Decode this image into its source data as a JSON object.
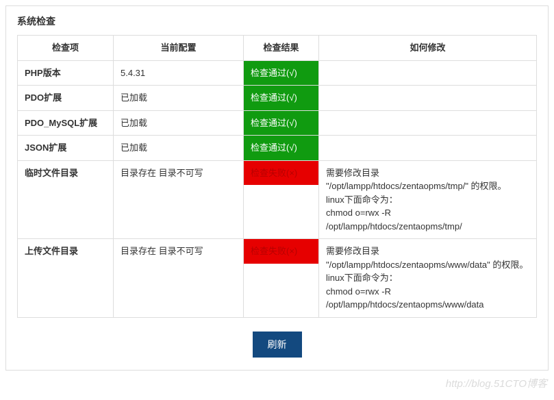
{
  "title": "系统检查",
  "headers": {
    "item": "检查项",
    "config": "当前配置",
    "result": "检查结果",
    "fix": "如何修改"
  },
  "status": {
    "pass": "检查通过(√)",
    "fail": "检查失败(×)"
  },
  "rows": [
    {
      "item": "PHP版本",
      "config": "5.4.31",
      "result": "pass",
      "fix": ""
    },
    {
      "item": "PDO扩展",
      "config": "已加载",
      "result": "pass",
      "fix": ""
    },
    {
      "item": "PDO_MySQL扩展",
      "config": "已加载",
      "result": "pass",
      "fix": ""
    },
    {
      "item": "JSON扩展",
      "config": "已加载",
      "result": "pass",
      "fix": ""
    },
    {
      "item": "临时文件目录",
      "config": "目录存在 目录不可写",
      "result": "fail",
      "fix": "需要修改目录\n\"/opt/lampp/htdocs/zentaopms/tmp/\" 的权限。\nlinux下面命令为：\nchmod o=rwx -R\n/opt/lampp/htdocs/zentaopms/tmp/"
    },
    {
      "item": "上传文件目录",
      "config": "目录存在 目录不可写",
      "result": "fail",
      "fix": "需要修改目录\n\"/opt/lampp/htdocs/zentaopms/www/data\" 的权限。\nlinux下面命令为：\nchmod o=rwx -R\n/opt/lampp/htdocs/zentaopms/www/data"
    }
  ],
  "refresh_label": "刷新",
  "watermark": "http://blog.51CTO博客"
}
